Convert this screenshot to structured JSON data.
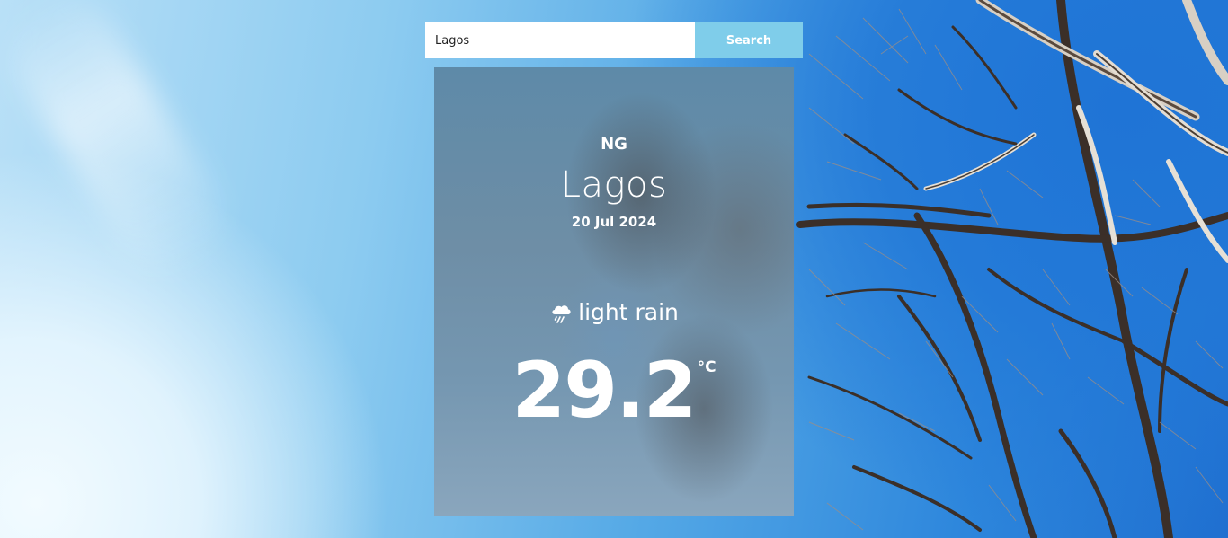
{
  "search": {
    "value": "Lagos",
    "button_label": "Search"
  },
  "weather": {
    "country": "NG",
    "city": "Lagos",
    "date": "20 Jul 2024",
    "condition": "light rain",
    "condition_icon": "rain-cloud-icon",
    "temperature": "29.2",
    "unit": "°C"
  },
  "colors": {
    "search_button_bg": "#7fcdea",
    "card_text": "#ffffff"
  }
}
